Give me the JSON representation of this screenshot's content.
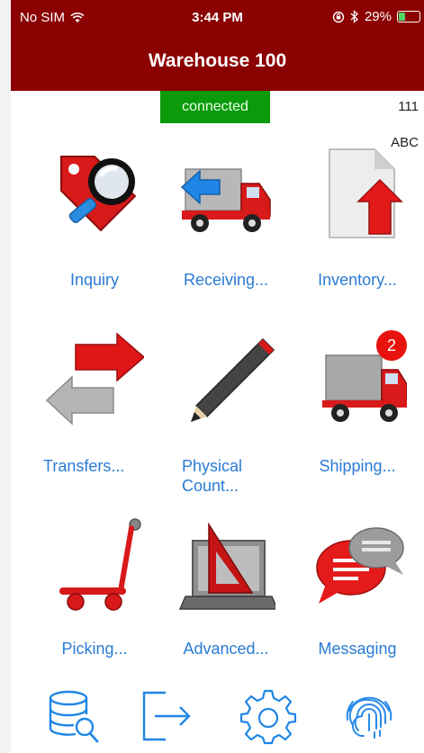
{
  "status": {
    "carrier": "No SIM",
    "time": "3:44 PM",
    "battery": "29%",
    "battery_level": 0.29
  },
  "header": {
    "title": "Warehouse 100"
  },
  "info": {
    "connection": "connected",
    "number": "111",
    "mode": "ABC"
  },
  "menu": [
    {
      "label": "Inquiry"
    },
    {
      "label": "Receiving..."
    },
    {
      "label": "Inventory..."
    },
    {
      "label": "Transfers..."
    },
    {
      "label": "Physical\nCount..."
    },
    {
      "label": "Shipping...",
      "badge": "2"
    },
    {
      "label": "Picking..."
    },
    {
      "label": "Advanced..."
    },
    {
      "label": "Messaging"
    }
  ],
  "colors": {
    "header": "#8b0000",
    "accent": "#2a7bd4",
    "connected": "#0a9a0a",
    "badge": "#e8130f"
  },
  "toolbar": {
    "icons": [
      "database-search-icon",
      "logout-icon",
      "settings-gear-icon",
      "fingerprint-icon"
    ]
  }
}
